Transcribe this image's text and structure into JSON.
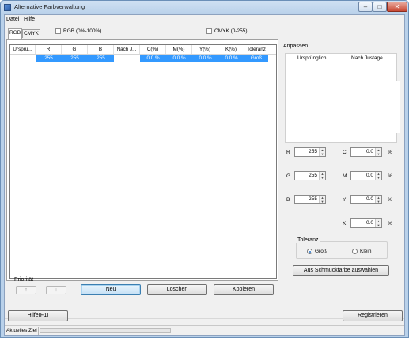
{
  "window": {
    "title": "Alternative Farbverwaltung"
  },
  "menu": [
    {
      "label": "Datei"
    },
    {
      "label": "Hilfe"
    }
  ],
  "tabs": [
    {
      "label": "RGB",
      "active": true
    },
    {
      "label": "CMYK",
      "active": false
    }
  ],
  "options": {
    "rgb_percent": {
      "label": "RGB (0%-100%)",
      "checked": false
    },
    "cmyk_range": {
      "label": "CMYK (0-255)",
      "checked": false
    }
  },
  "table": {
    "columns": [
      "Ursprü...",
      "R",
      "G",
      "B",
      "Nach J...",
      "C(%)",
      "M(%)",
      "Y(%)",
      "K(%)",
      "Toleranz"
    ],
    "rows": [
      {
        "cells": [
          "",
          "255",
          "255",
          "255",
          "",
          "0.0 %",
          "0.0 %",
          "0.0 %",
          "0.0 %",
          "Groß"
        ]
      }
    ]
  },
  "priority": {
    "label": "Priorität",
    "up_label": "↑",
    "down_label": "↓"
  },
  "buttons": {
    "new": "Neu",
    "delete": "Löschen",
    "copy": "Kopieren",
    "help": "Hilfe(F1)",
    "register": "Registrieren",
    "select_spot": "Aus Schmuckfarbe auswählen"
  },
  "adjust": {
    "title": "Anpassen",
    "original_label": "Ursprünglich",
    "after_label": "Nach Justage",
    "r": {
      "label": "R",
      "value": "255"
    },
    "g": {
      "label": "G",
      "value": "255"
    },
    "b": {
      "label": "B",
      "value": "255"
    },
    "c": {
      "label": "C",
      "value": "0.0",
      "unit": "%"
    },
    "m": {
      "label": "M",
      "value": "0.0",
      "unit": "%"
    },
    "y": {
      "label": "Y",
      "value": "0.0",
      "unit": "%"
    },
    "k": {
      "label": "K",
      "value": "0.0",
      "unit": "%"
    }
  },
  "tolerance": {
    "title": "Toleranz",
    "options": [
      {
        "label": "Groß",
        "selected": true
      },
      {
        "label": "Klein",
        "selected": false
      }
    ]
  },
  "status": {
    "text": "Aktuelles Ziel",
    "progress_fraction": 0.0
  },
  "colors": {
    "selection": "#3399ff",
    "progress": "#06b025"
  }
}
